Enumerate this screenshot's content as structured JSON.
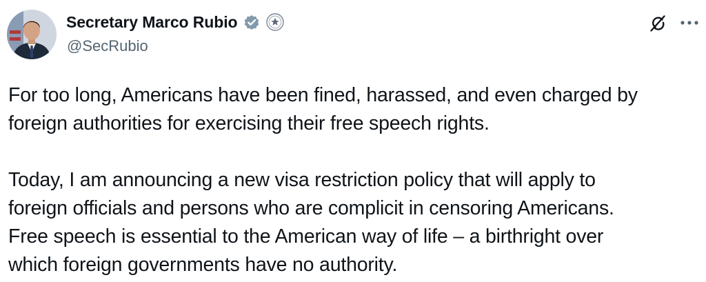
{
  "author": {
    "display_name": "Secretary Marco Rubio",
    "handle": "@SecRubio",
    "verified_icon": "verified-check-icon",
    "affiliation_icon": "state-department-seal-icon",
    "avatar_icon": "profile-photo"
  },
  "actions": {
    "grok_icon": "grok-icon",
    "more_icon": "more-options-icon"
  },
  "colors": {
    "text_primary": "#0f1419",
    "text_secondary": "#536471",
    "verified": "#829aab"
  },
  "tweet": {
    "paragraphs": [
      "For too long, Americans have been fined, harassed, and even charged by\nforeign authorities for exercising their free speech rights.",
      "Today, I am announcing a new visa restriction policy that will apply to\nforeign officials and persons who are complicit in censoring Americans.\nFree speech is essential to the American way of life – a birthright over\nwhich foreign governments have no authority."
    ]
  }
}
